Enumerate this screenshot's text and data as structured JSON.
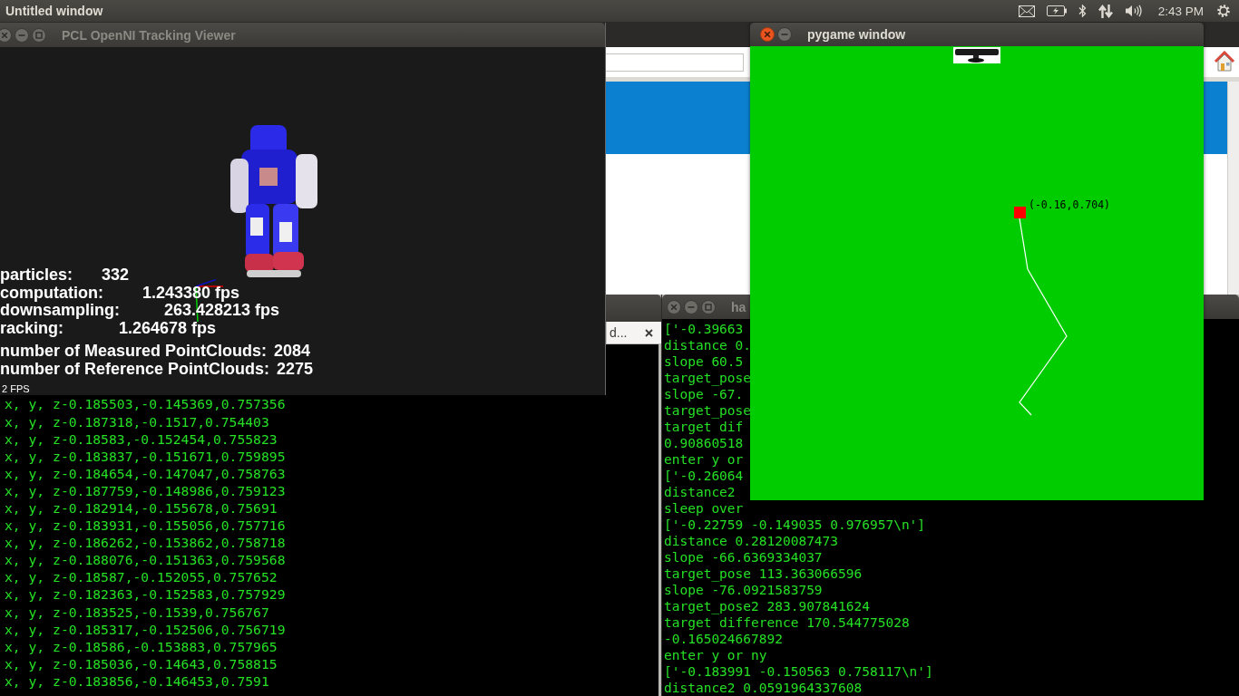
{
  "top_panel": {
    "title": "Untitled window",
    "clock": "2:43 PM"
  },
  "pcl_viewer": {
    "title": "PCL OpenNI Tracking Viewer",
    "active": false,
    "stats": [
      {
        "label": "particles:",
        "value": "332"
      },
      {
        "label": "computation:",
        "value": "1.243380 fps"
      },
      {
        "label": "downsampling:",
        "value": "263.428213 fps"
      },
      {
        "label": "racking:",
        "value": "1.264678 fps"
      }
    ],
    "counts": [
      {
        "label": "number of Measured PointClouds:",
        "value": "2084"
      },
      {
        "label": "number of Reference PointClouds:",
        "value": "2275"
      }
    ],
    "fps": "2 FPS"
  },
  "pygame_window": {
    "title": "pygame window",
    "active": true,
    "marker_label": "(-0.16,0.704)"
  },
  "terminal_left": {
    "tab": "d...",
    "lines": [
      "x, y, z-0.185503,-0.145369,0.757356",
      "x, y, z-0.187318,-0.1517,0.754403",
      "x, y, z-0.18583,-0.152454,0.755823",
      "x, y, z-0.183837,-0.151671,0.759895",
      "x, y, z-0.184654,-0.147047,0.758763",
      "x, y, z-0.187759,-0.148986,0.759123",
      "x, y, z-0.182914,-0.155678,0.75691",
      "x, y, z-0.183931,-0.155056,0.757716",
      "x, y, z-0.186262,-0.153862,0.758718",
      "x, y, z-0.188076,-0.151363,0.759568",
      "x, y, z-0.18587,-0.152055,0.757652",
      "x, y, z-0.182363,-0.152583,0.757929",
      "x, y, z-0.183525,-0.1539,0.756767",
      "x, y, z-0.185317,-0.152506,0.756719",
      "x, y, z-0.18586,-0.153883,0.757965",
      "x, y, z-0.185036,-0.14643,0.758815",
      "x, y, z-0.183856,-0.146453,0.7591"
    ]
  },
  "terminal_right": {
    "title": "ha",
    "active": false,
    "lines": [
      "['-0.39663",
      "distance 0.",
      "slope 60.5",
      "target_pose",
      "slope -67.",
      "target_pose",
      "target dif",
      "0.90860518",
      "enter y or",
      "['-0.26064",
      "distance2",
      "sleep over",
      "['-0.22759 -0.149035 0.976957\\n']",
      "distance 0.28120087473",
      "slope -66.6369334037",
      "target_pose 113.363066596",
      "slope -76.0921583759",
      "target_pose2 283.907841624",
      "target difference 170.544775028",
      "-0.165024667892",
      "enter y or ny",
      "['-0.183991 -0.150563 0.758117\\n']",
      "distance2 0.0591964337608"
    ]
  }
}
